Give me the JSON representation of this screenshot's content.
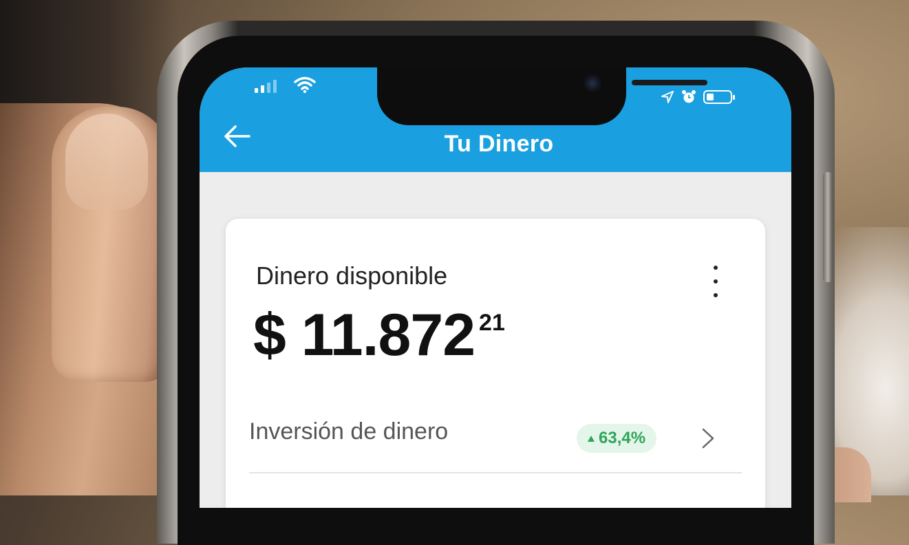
{
  "status_bar": {
    "left_icons": [
      "signal-icon",
      "wifi-icon"
    ],
    "right_icons": [
      "location-arrow-icon",
      "alarm-clock-icon",
      "battery-icon"
    ]
  },
  "app_bar": {
    "title": "Tu Dinero",
    "back_icon": "arrow-left-icon",
    "color": "#1aa0e0"
  },
  "balance_card": {
    "label": "Dinero disponible",
    "amount_main": "$ 11.872",
    "amount_cents": "21",
    "menu_icon": "more-vertical-icon"
  },
  "investment_row": {
    "label": "Inversión de dinero",
    "badge": "63,4%",
    "badge_icon": "triangle-up-icon",
    "badge_color": "#2ea55a",
    "chevron_icon": "chevron-right-icon"
  }
}
